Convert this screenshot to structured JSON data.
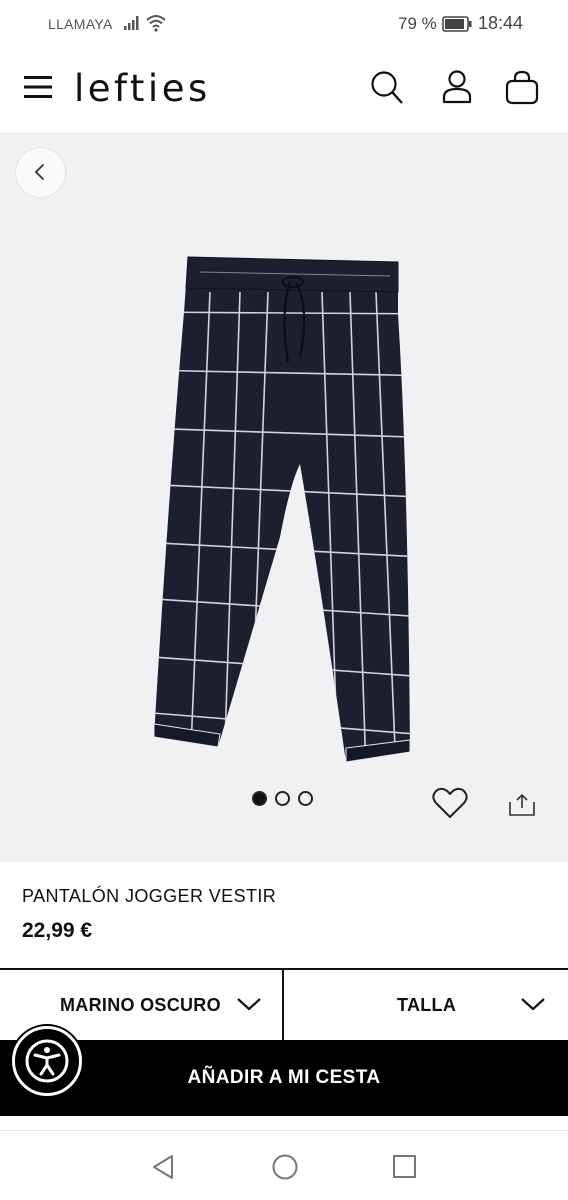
{
  "status_bar": {
    "carrier": "LLAMAYA",
    "battery_percent": "79 %",
    "time": "18:44",
    "icons": [
      "signal-icon",
      "wifi-icon",
      "battery-icon"
    ]
  },
  "header": {
    "logo": "lefties",
    "icons": [
      "menu-icon",
      "search-icon",
      "user-icon",
      "shopping-bag-icon"
    ]
  },
  "gallery": {
    "image_count": 3,
    "active_image": 1,
    "icons": [
      "back-arrow-icon",
      "heart-icon",
      "share-icon"
    ]
  },
  "product": {
    "name": "PANTALÓN JOGGER VESTIR",
    "price": "22,99 €"
  },
  "selectors": {
    "color_label": "MARINO OSCURO",
    "size_label": "TALLA"
  },
  "cart": {
    "add_label": "AÑADIR A MI CESTA"
  },
  "colors": {
    "brand": "#000000",
    "gallery_bg": "#f1f1f3",
    "product_fabric": "#1b1f2e"
  }
}
